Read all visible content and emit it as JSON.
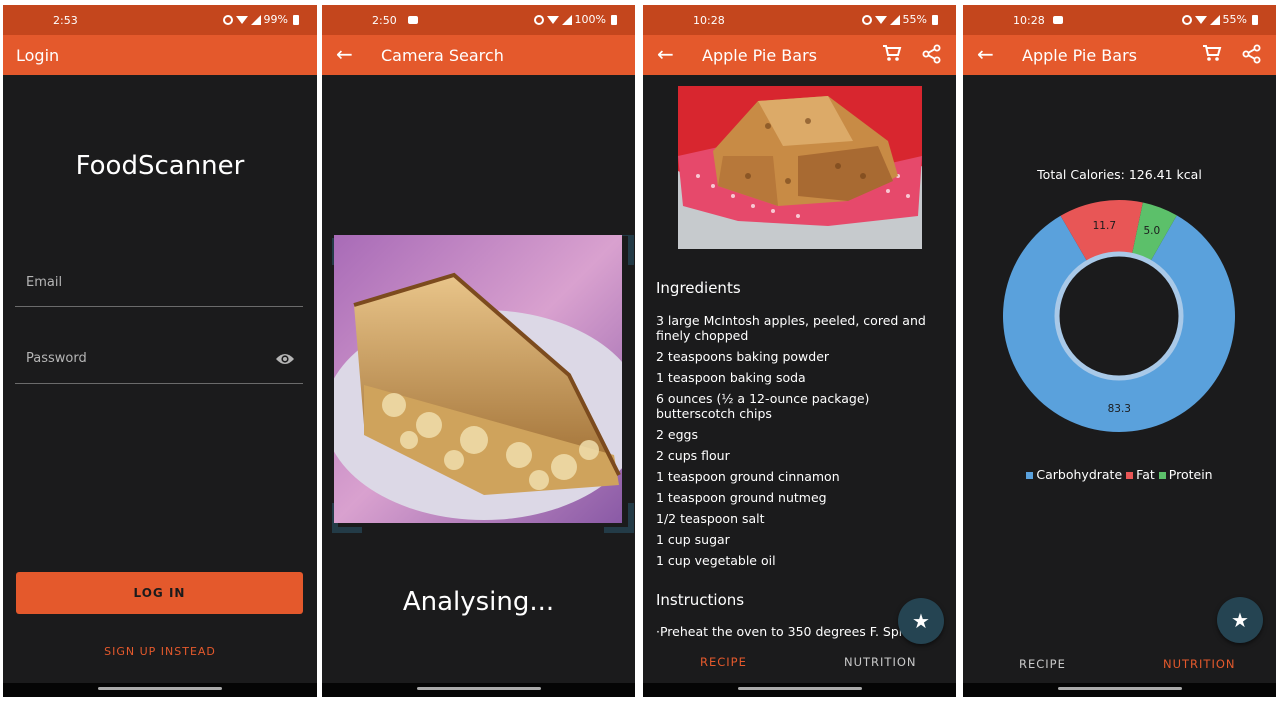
{
  "screens": {
    "login": {
      "status_time": "2:53",
      "status_battery": "99%",
      "appbar_title": "Login",
      "brand": "FoodScanner",
      "email_label": "Email",
      "password_label": "Password",
      "login_button": "LOG IN",
      "signup_link": "SIGN UP INSTEAD"
    },
    "camera": {
      "status_time": "2:50",
      "status_battery": "100%",
      "appbar_title": "Camera Search",
      "status_text": "Analysing..."
    },
    "recipe": {
      "status_time": "10:28",
      "status_battery": "55%",
      "appbar_title": "Apple Pie Bars",
      "ingredients_heading": "Ingredients",
      "ingredients": [
        "3 large McIntosh apples, peeled, cored and finely chopped",
        "2 teaspoons baking powder",
        "1 teaspoon baking soda",
        "6 ounces (½ a 12-ounce package) butterscotch chips",
        "2 eggs",
        "2 cups flour",
        "1 teaspoon ground cinnamon",
        "1 teaspoon ground nutmeg",
        "1/2 teaspoon salt",
        "1 cup sugar",
        "1 cup vegetable oil"
      ],
      "instructions_heading": "Instructions",
      "instructions_text": "·Preheat the oven to 350 degrees F. Spray",
      "tab_recipe": "RECIPE",
      "tab_nutrition": "NUTRITION",
      "active_tab": "RECIPE"
    },
    "nutrition": {
      "status_time": "10:28",
      "status_battery": "55%",
      "appbar_title": "Apple Pie Bars",
      "total_calories": "Total Calories: 126.41 kcal",
      "tab_recipe": "RECIPE",
      "tab_nutrition": "NUTRITION",
      "active_tab": "NUTRITION"
    }
  },
  "colors": {
    "status_bar": "#c4461d",
    "app_bar": "#e4592c",
    "background": "#1b1b1c",
    "fab": "#254452",
    "carbohydrate": "#5aa1dc",
    "fat": "#e85656",
    "protein": "#5cc06a"
  },
  "icons": {
    "back": "arrow-left-icon",
    "cart": "cart-icon",
    "share": "share-icon",
    "eye": "eye-icon",
    "favorite": "star-icon"
  },
  "chart_data": {
    "type": "pie",
    "title": "Total Calories: 126.41 kcal",
    "categories": [
      "Carbohydrate",
      "Fat",
      "Protein"
    ],
    "values": [
      83.3,
      11.7,
      5.0
    ],
    "labels": [
      "83.3",
      "11.7",
      "5.0"
    ],
    "legend_position": "bottom"
  }
}
